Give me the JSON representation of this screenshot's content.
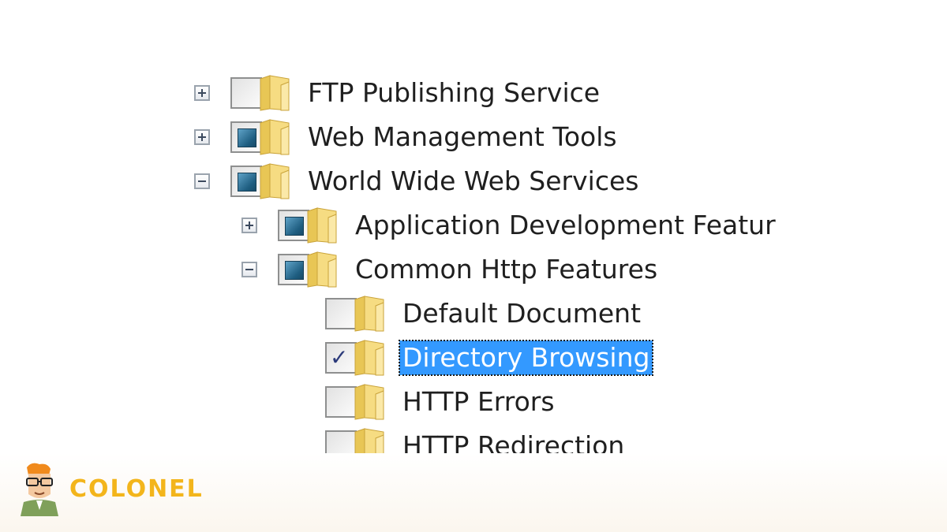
{
  "tree": {
    "items": [
      {
        "label": "FTP Publishing Service",
        "expander": "plus",
        "check": "unchecked",
        "level": 0
      },
      {
        "label": "Web Management Tools",
        "expander": "plus",
        "check": "partial",
        "level": 0
      },
      {
        "label": "World Wide Web Services",
        "expander": "minus",
        "check": "partial",
        "level": 0
      },
      {
        "label": "Application Development Featur",
        "expander": "plus",
        "check": "partial",
        "level": 1
      },
      {
        "label": "Common Http Features",
        "expander": "minus",
        "check": "partial",
        "level": 1
      },
      {
        "label": "Default Document",
        "expander": "none",
        "check": "unchecked",
        "level": 2
      },
      {
        "label": "Directory Browsing",
        "expander": "none",
        "check": "checked",
        "level": 2,
        "selected": true
      },
      {
        "label": "HTTP Errors",
        "expander": "none",
        "check": "unchecked",
        "level": 2
      },
      {
        "label": "HTTP Redirection",
        "expander": "none",
        "check": "unchecked",
        "level": 2
      }
    ]
  },
  "icons": {
    "expander": "plus-minus-icon",
    "folder": "folder-icon",
    "check": "checkmark-icon"
  },
  "colors": {
    "selection": "#3399ff",
    "partial_fill": "#1e5d80",
    "folder": "#f2d36b",
    "brand": "#f3b51b"
  },
  "brand": {
    "name": "COLONEL"
  }
}
